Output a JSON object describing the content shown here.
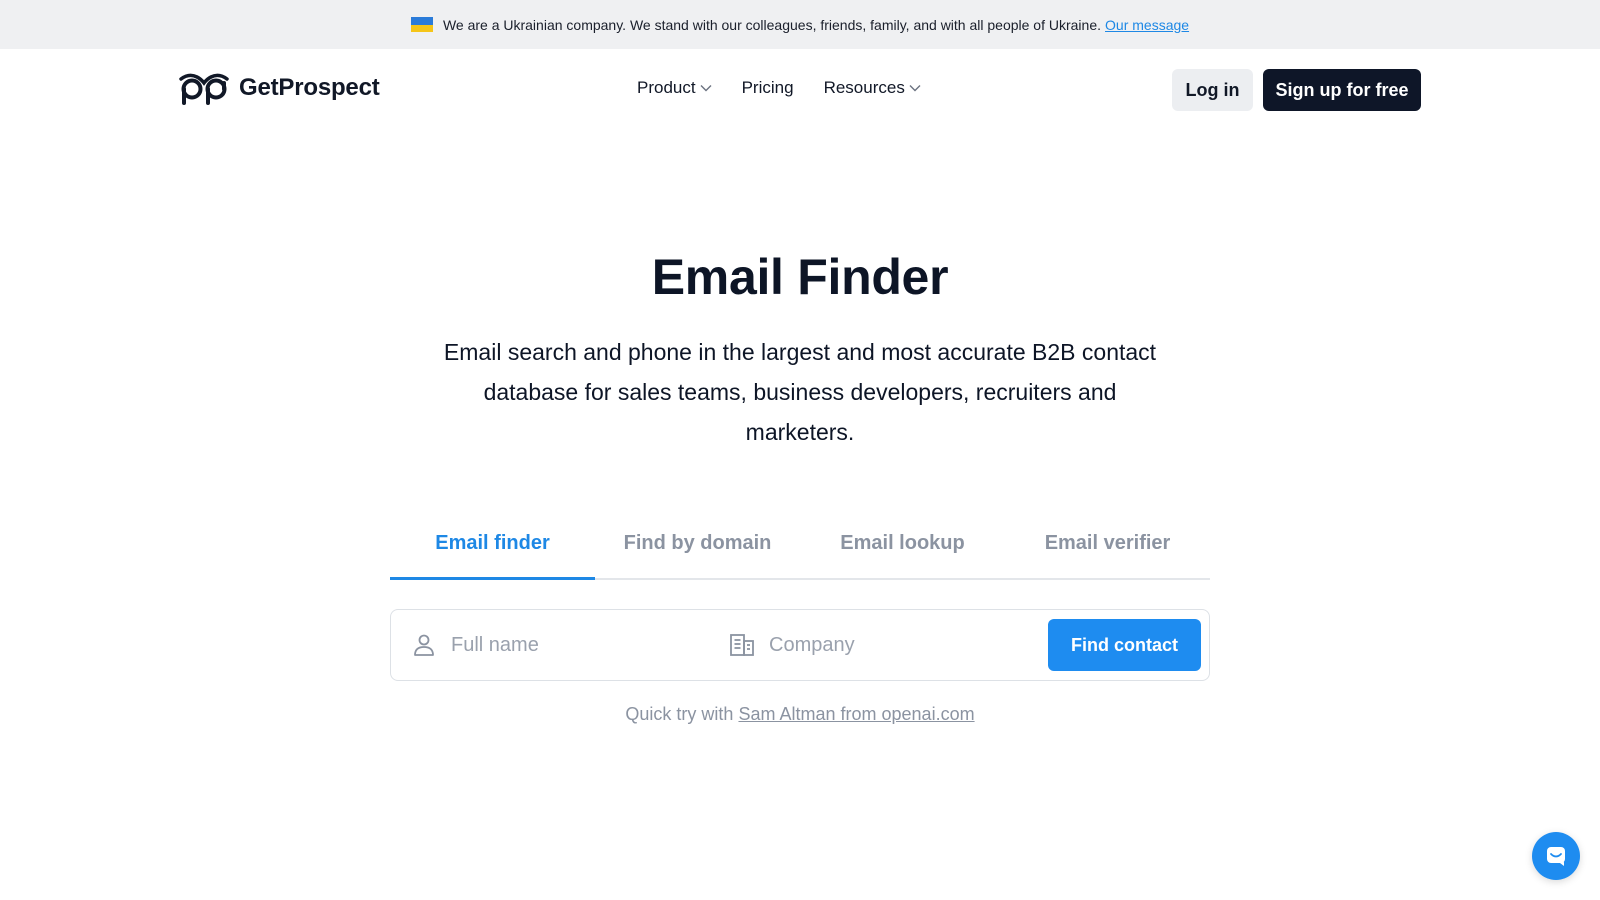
{
  "banner": {
    "message": "We are a Ukrainian company. We stand with our colleagues, friends, family, and with all people of Ukraine.",
    "link": "Our message",
    "flag_colors": [
      "#2a7bd9",
      "#f5c518"
    ]
  },
  "header": {
    "brand": "GetProspect",
    "nav": [
      {
        "label": "Product",
        "dropdown": true
      },
      {
        "label": "Pricing",
        "dropdown": false
      },
      {
        "label": "Resources",
        "dropdown": true
      }
    ],
    "login": "Log in",
    "signup": "Sign up for free"
  },
  "hero": {
    "title": "Email Finder",
    "subtitle": "Email search and phone in the largest and most accurate B2B contact database for sales teams, business developers, recruiters and marketers."
  },
  "tabs": [
    {
      "label": "Email finder",
      "active": true
    },
    {
      "label": "Find by domain",
      "active": false
    },
    {
      "label": "Email lookup",
      "active": false
    },
    {
      "label": "Email verifier",
      "active": false
    }
  ],
  "search": {
    "name_placeholder": "Full name",
    "name_value": "",
    "company_placeholder": "Company",
    "company_value": "",
    "button": "Find contact"
  },
  "quick_try": {
    "prefix": "Quick try with",
    "link": "Sam Altman from openai.com"
  },
  "colors": {
    "accent": "#1e88e5",
    "dark": "#0e1628"
  },
  "icons": {
    "chat": "chat-bubble-icon",
    "person": "person-icon",
    "company": "building-icon"
  }
}
